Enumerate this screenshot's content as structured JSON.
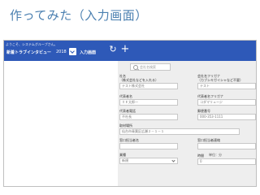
{
  "slide": {
    "title": "作ってみた（入力画面）"
  },
  "app": {
    "welcome": "ようこそ、システムグループさん。",
    "title": "新着トラブインタビュー",
    "year": "2018",
    "screen_name": "入力画面"
  },
  "toolbar": {
    "refresh_icon": "refresh-icon",
    "add_icon": "plus-icon"
  },
  "search": {
    "placeholder": "会社名検索"
  },
  "form": {
    "company_name": {
      "label": "社名",
      "sublabel": "（株式会社などを入れる）",
      "value": "テスト株式会社"
    },
    "company_kana": {
      "label": "会社名フリガナ",
      "sublabel": "（カブシキガイシャなど不要）",
      "value": "テスト"
    },
    "representative": {
      "label": "代表者名",
      "value": "ＩＥ太郎一"
    },
    "representative_kana": {
      "label": "代表者名フリガナ",
      "value": "コダマリュージ"
    },
    "rep_phone": {
      "label": "代表者電話",
      "value": "不社長"
    },
    "postal_code": {
      "label": "郵便番号",
      "value": "000-353-1111"
    },
    "address": {
      "label": "取材場所",
      "value": "仙台市青葉区広瀬２－１－１"
    },
    "contact_name": {
      "label": "窓口担当者名",
      "value": ""
    },
    "contact_phone": {
      "label": "窓口担当者連絡",
      "value": ""
    },
    "category": {
      "label": "業種",
      "value": "新規"
    },
    "duration": {
      "label": "時間",
      "unit": "単位：分",
      "value": "0"
    }
  }
}
